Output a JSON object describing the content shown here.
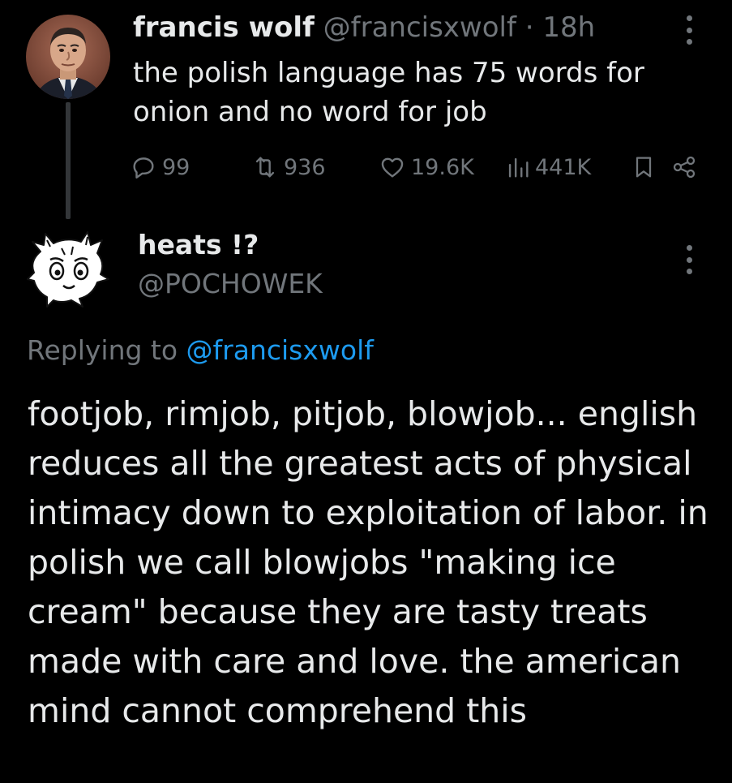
{
  "original_tweet": {
    "author_name": "francis wolf",
    "handle": "@francisxwolf",
    "separator": " · ",
    "time": "18h",
    "text": "the polish language has 75 words for onion and no word for job",
    "actions": {
      "replies": "99",
      "retweets": "936",
      "likes": "19.6K",
      "views": "441K"
    }
  },
  "reply_tweet": {
    "author_name": "heats !?",
    "handle": "@POCHOWEK",
    "replying_prefix": "Replying to ",
    "replying_to": "@francisxwolf",
    "text": "footjob, rimjob, pitjob, blowjob... english reduces all the greatest acts of physical intimacy down to exploitation of labor. in polish we call blowjobs \"making ice cream\" because they are tasty treats made with care and love. the american mind cannot comprehend this"
  },
  "colors": {
    "background": "#000000",
    "primary_text": "#e7e9ea",
    "secondary_text": "#71767b",
    "link": "#1d9bf0"
  },
  "icons": [
    "more-icon",
    "reply-icon",
    "retweet-icon",
    "like-icon",
    "views-icon",
    "bookmark-icon",
    "share-icon"
  ]
}
